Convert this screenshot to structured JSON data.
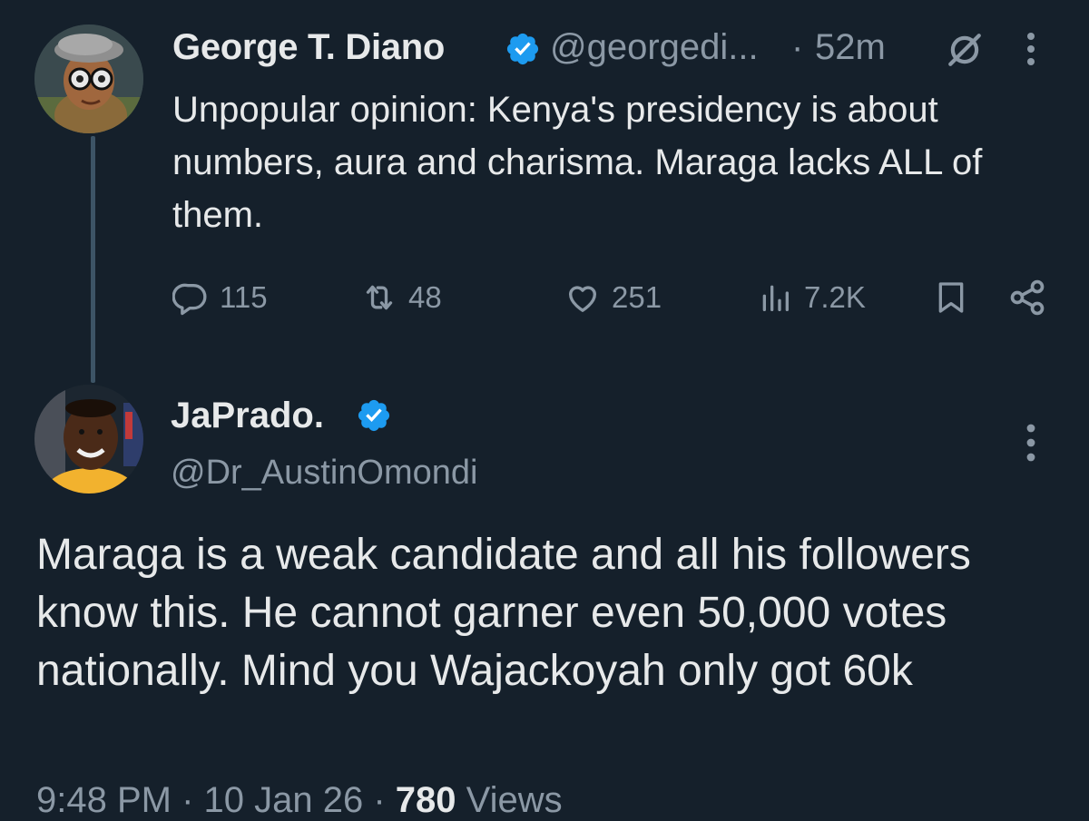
{
  "parent_tweet": {
    "author_name": "George T. Diano",
    "handle": "@georgedi...",
    "separator": "·",
    "time": "52m",
    "text": "Unpopular opinion: Kenya's presidency is about numbers, aura and charisma. Maraga lacks ALL of them.",
    "actions": {
      "replies": "115",
      "retweets": "48",
      "likes": "251",
      "views": "7.2K"
    },
    "icons": [
      "verified-badge-icon",
      "grok-icon",
      "more-options-icon",
      "reply-icon",
      "retweet-icon",
      "like-icon",
      "views-icon",
      "bookmark-icon",
      "share-icon"
    ]
  },
  "reply_tweet": {
    "author_name": "JaPrado.",
    "handle": "@Dr_AustinOmondi",
    "text": "Maraga is a weak candidate and all his followers know this. He cannot garner even 50,000 votes nationally. Mind you Wajackoyah only got 60k",
    "footer": {
      "time": "9:48 PM · 10 Jan 26 · ",
      "views": "780",
      "views_label": " Views"
    }
  },
  "colors": {
    "background": "#15202b",
    "text_primary": "#e7e9ea",
    "text_secondary": "#8b98a5",
    "verified_blue": "#1d9bf0",
    "thread_line": "#3d5466"
  }
}
